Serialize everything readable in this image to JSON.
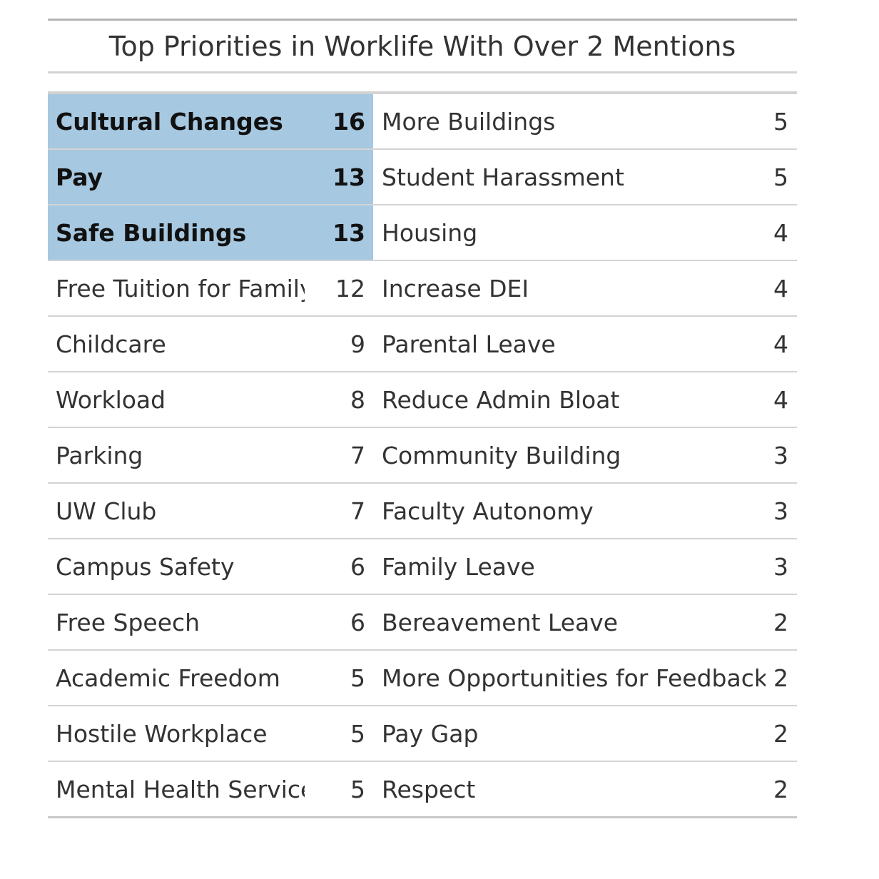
{
  "chart_data": {
    "type": "table",
    "title": "Top Priorities in Worklife With Over 2 Mentions",
    "highlight_color": "#a6c8e0",
    "highlighted_rows": [
      0,
      1,
      2
    ],
    "rows": [
      {
        "left_label": "Cultural Changes",
        "left_value": 16,
        "right_label": "More Buildings",
        "right_value": 5
      },
      {
        "left_label": "Pay",
        "left_value": 13,
        "right_label": "Student Harassment",
        "right_value": 5
      },
      {
        "left_label": "Safe Buildings",
        "left_value": 13,
        "right_label": "Housing",
        "right_value": 4
      },
      {
        "left_label": "Free Tuition for Family",
        "left_value": 12,
        "right_label": "Increase DEI",
        "right_value": 4
      },
      {
        "left_label": "Childcare",
        "left_value": 9,
        "right_label": "Parental Leave",
        "right_value": 4
      },
      {
        "left_label": "Workload",
        "left_value": 8,
        "right_label": "Reduce Admin Bloat",
        "right_value": 4
      },
      {
        "left_label": "Parking",
        "left_value": 7,
        "right_label": "Community Building",
        "right_value": 3
      },
      {
        "left_label": "UW Club",
        "left_value": 7,
        "right_label": "Faculty Autonomy",
        "right_value": 3
      },
      {
        "left_label": "Campus Safety",
        "left_value": 6,
        "right_label": "Family Leave",
        "right_value": 3
      },
      {
        "left_label": "Free Speech",
        "left_value": 6,
        "right_label": "Bereavement Leave",
        "right_value": 2
      },
      {
        "left_label": "Academic Freedom",
        "left_value": 5,
        "right_label": "More Opportunities for Feedback",
        "right_value": 2
      },
      {
        "left_label": "Hostile Workplace",
        "left_value": 5,
        "right_label": "Pay Gap",
        "right_value": 2
      },
      {
        "left_label": "Mental Health Services",
        "left_value": 5,
        "right_label": "Respect",
        "right_value": 2
      }
    ]
  }
}
